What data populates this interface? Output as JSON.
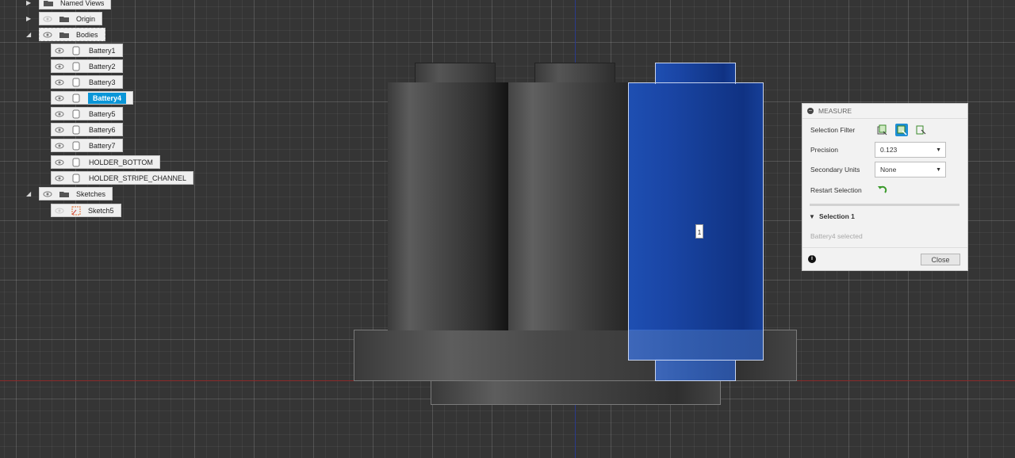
{
  "browser": {
    "items": [
      {
        "label": "Named Views"
      },
      {
        "label": "Origin"
      },
      {
        "label": "Bodies"
      },
      {
        "label": "Battery1"
      },
      {
        "label": "Battery2"
      },
      {
        "label": "Battery3"
      },
      {
        "label": "Battery4",
        "selected": true
      },
      {
        "label": "Battery5"
      },
      {
        "label": "Battery6"
      },
      {
        "label": "Battery7"
      },
      {
        "label": "HOLDER_BOTTOM"
      },
      {
        "label": "HOLDER_STRIPE_CHANNEL"
      },
      {
        "label": "Sketches"
      },
      {
        "label": "Sketch5"
      }
    ]
  },
  "measure": {
    "title": "MEASURE",
    "selection_filter_label": "Selection Filter",
    "precision_label": "Precision",
    "precision_value": "0.123",
    "secondary_units_label": "Secondary Units",
    "secondary_units_value": "None",
    "restart_label": "Restart Selection",
    "selection_heading": "Selection 1",
    "selection_status": "Battery4 selected",
    "close_label": "Close"
  },
  "viewport": {
    "marker_label": "1"
  },
  "colors": {
    "selection_blue": "#0a96d8",
    "body_highlight": "#1e4fb2",
    "background": "#353535"
  }
}
